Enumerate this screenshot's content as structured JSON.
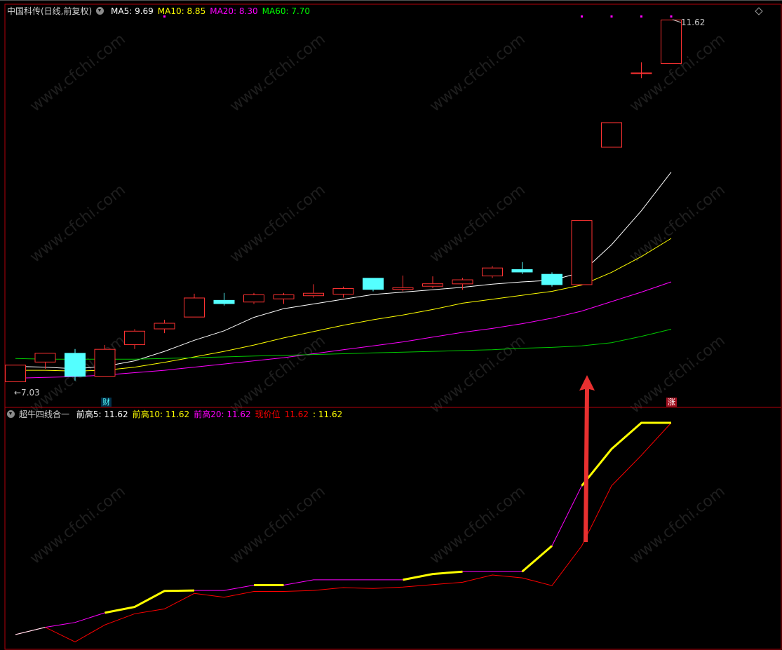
{
  "main_panel": {
    "title": "中国科传(日线,前复权)",
    "ma_labels": [
      {
        "label": "MA5: 9.69",
        "color": "#ffffff"
      },
      {
        "label": "MA10: 8.85",
        "color": "#ffff00"
      },
      {
        "label": "MA20: 8.30",
        "color": "#ff00ff"
      },
      {
        "label": "MA60: 7.70",
        "color": "#00ff00"
      }
    ],
    "high_marker": "11.62",
    "low_marker": "7.03",
    "finance_badge": "财",
    "limit_up_badge": "涨"
  },
  "indicator_panel": {
    "title": "超牛四线合一",
    "labels": [
      {
        "label": "前高5: 11.62",
        "color": "#ffffff"
      },
      {
        "label": "前高10: 11.62",
        "color": "#ffff00"
      },
      {
        "label": "前高20: 11.62",
        "color": "#ff00ff"
      },
      {
        "label": "现价位",
        "color": "#ff0000"
      },
      {
        "label": "11.62",
        "color": "#ff0000"
      },
      {
        "label": ": 11.62",
        "color": "#ffff00"
      }
    ]
  },
  "watermark": "www.cfchi.com",
  "colors": {
    "up": "#ff3232",
    "down": "#54ffff",
    "ma5": "#ffffff",
    "ma10": "#ffff00",
    "ma20": "#ff00ff",
    "ma60": "#00c800",
    "border": "#b4000a",
    "arrow": "#e83030"
  },
  "chart_data": [
    {
      "type": "candlestick",
      "title": "中国科传(日线,前复权)",
      "ylim": [
        6.9,
        11.75
      ],
      "candles": [
        {
          "o": 7.03,
          "c": 7.25,
          "h": 7.25,
          "l": 7.03
        },
        {
          "o": 7.28,
          "c": 7.4,
          "h": 7.4,
          "l": 7.2
        },
        {
          "o": 7.4,
          "c": 7.1,
          "h": 7.45,
          "l": 7.05
        },
        {
          "o": 7.1,
          "c": 7.45,
          "h": 7.5,
          "l": 7.1
        },
        {
          "o": 7.5,
          "c": 7.68,
          "h": 7.7,
          "l": 7.45
        },
        {
          "o": 7.7,
          "c": 7.78,
          "h": 7.82,
          "l": 7.65
        },
        {
          "o": 7.85,
          "c": 8.1,
          "h": 8.15,
          "l": 7.85
        },
        {
          "o": 8.07,
          "c": 8.02,
          "h": 8.16,
          "l": 8.0
        },
        {
          "o": 8.04,
          "c": 8.14,
          "h": 8.16,
          "l": 8.02
        },
        {
          "o": 8.08,
          "c": 8.14,
          "h": 8.16,
          "l": 8.02
        },
        {
          "o": 8.12,
          "c": 8.16,
          "h": 8.27,
          "l": 8.1
        },
        {
          "o": 8.14,
          "c": 8.22,
          "h": 8.24,
          "l": 8.1
        },
        {
          "o": 8.35,
          "c": 8.2,
          "h": 8.35,
          "l": 8.18
        },
        {
          "o": 8.2,
          "c": 8.23,
          "h": 8.38,
          "l": 8.18
        },
        {
          "o": 8.24,
          "c": 8.28,
          "h": 8.37,
          "l": 8.22
        },
        {
          "o": 8.27,
          "c": 8.33,
          "h": 8.35,
          "l": 8.2
        },
        {
          "o": 8.37,
          "c": 8.48,
          "h": 8.5,
          "l": 8.35
        },
        {
          "o": 8.46,
          "c": 8.42,
          "h": 8.55,
          "l": 8.4
        },
        {
          "o": 8.4,
          "c": 8.26,
          "h": 8.42,
          "l": 8.24
        },
        {
          "o": 8.26,
          "c": 9.08,
          "h": 9.08,
          "l": 8.26
        },
        {
          "o": 10.0,
          "c": 10.32,
          "h": 10.32,
          "l": 10.0
        },
        {
          "o": 10.95,
          "c": 10.95,
          "h": 11.08,
          "l": 10.88
        },
        {
          "o": 11.06,
          "c": 11.62,
          "h": 11.62,
          "l": 11.06
        }
      ],
      "series": [
        {
          "name": "MA5",
          "values": [
            7.23,
            7.22,
            7.2,
            7.23,
            7.3,
            7.42,
            7.56,
            7.68,
            7.85,
            7.96,
            8.02,
            8.08,
            8.14,
            8.17,
            8.2,
            8.23,
            8.27,
            8.3,
            8.32,
            8.42,
            8.77,
            9.2,
            9.69
          ]
        },
        {
          "name": "MA10",
          "values": [
            7.18,
            7.18,
            7.17,
            7.18,
            7.22,
            7.28,
            7.35,
            7.42,
            7.5,
            7.59,
            7.67,
            7.75,
            7.82,
            7.88,
            7.95,
            8.03,
            8.08,
            8.13,
            8.18,
            8.26,
            8.42,
            8.62,
            8.85
          ]
        },
        {
          "name": "MA20",
          "values": [
            7.08,
            7.09,
            7.1,
            7.12,
            7.15,
            7.18,
            7.22,
            7.26,
            7.3,
            7.34,
            7.39,
            7.44,
            7.49,
            7.54,
            7.6,
            7.66,
            7.71,
            7.77,
            7.84,
            7.93,
            8.05,
            8.17,
            8.3
          ]
        },
        {
          "name": "MA60",
          "values": [
            7.33,
            7.32,
            7.32,
            7.32,
            7.32,
            7.33,
            7.34,
            7.35,
            7.36,
            7.37,
            7.38,
            7.39,
            7.4,
            7.41,
            7.42,
            7.43,
            7.44,
            7.46,
            7.47,
            7.49,
            7.53,
            7.61,
            7.7
          ]
        }
      ]
    },
    {
      "type": "line",
      "title": "超牛四线合一",
      "ylim": [
        6.9,
        11.75
      ],
      "series": [
        {
          "name": "前高5",
          "values": [
            7.25,
            7.4,
            7.5,
            7.7,
            7.82,
            8.15,
            8.16,
            8.16,
            8.27,
            8.27,
            8.38,
            8.38,
            8.38,
            8.38,
            8.5,
            8.55,
            8.55,
            8.55,
            9.08,
            10.32,
            11.08,
            11.62
          ]
        },
        {
          "name": "现价位",
          "values": [
            7.25,
            7.4,
            7.1,
            7.45,
            7.68,
            7.78,
            8.1,
            8.02,
            8.14,
            8.14,
            8.16,
            8.22,
            8.2,
            8.23,
            8.28,
            8.33,
            8.48,
            8.42,
            8.26,
            9.08,
            10.32,
            10.95,
            11.62
          ]
        }
      ]
    }
  ]
}
